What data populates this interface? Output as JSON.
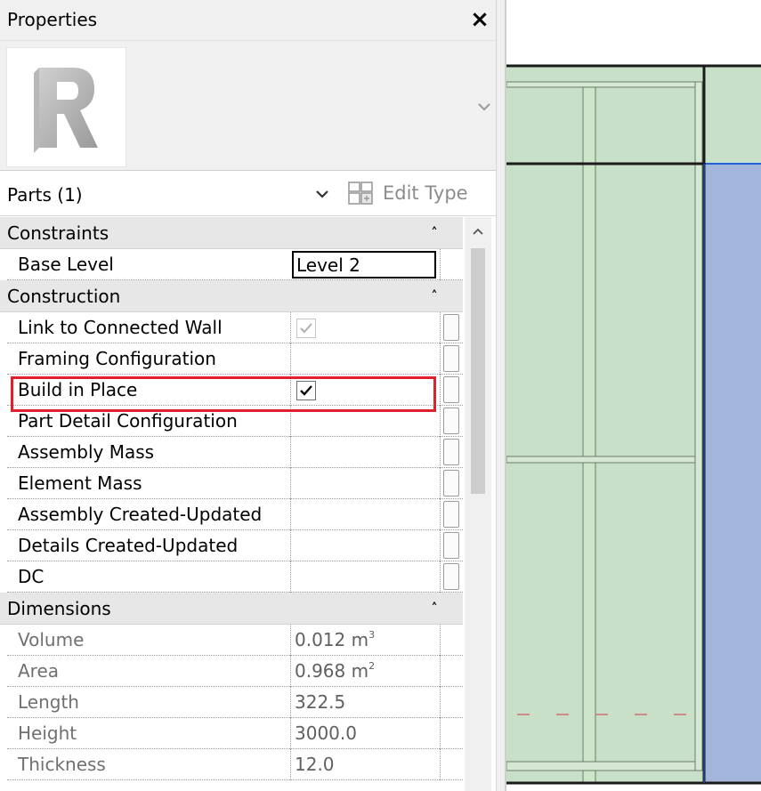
{
  "palette": {
    "title": "Properties",
    "close_glyph": "×",
    "type_image_icon": "revit-logo-icon",
    "filter_label": "Parts (1)",
    "edit_type_label": "Edit Type"
  },
  "groups": [
    {
      "label": "Constraints"
    },
    {
      "label": "Construction"
    },
    {
      "label": "Dimensions"
    }
  ],
  "constraints": {
    "base_level": {
      "name": "Base Level",
      "value": "Level 2"
    }
  },
  "construction": {
    "link_to_connected_wall": {
      "name": "Link to Connected Wall",
      "checked": true,
      "enabled": false
    },
    "framing_configuration": {
      "name": "Framing Configuration",
      "value": ""
    },
    "build_in_place": {
      "name": "Build in Place",
      "checked": true,
      "enabled": true
    },
    "part_detail_configuration": {
      "name": "Part Detail Configuration",
      "value": ""
    },
    "assembly_mass": {
      "name": "Assembly Mass",
      "value": ""
    },
    "element_mass": {
      "name": "Element Mass",
      "value": ""
    },
    "assembly_created_updated": {
      "name": "Assembly Created-Updated",
      "value": ""
    },
    "details_created_updated": {
      "name": "Details Created-Updated",
      "value": ""
    },
    "dc": {
      "name": "DC",
      "value": ""
    }
  },
  "dimensions": {
    "volume": {
      "name": "Volume",
      "value": "0.012 m",
      "unit_exp": "3"
    },
    "area": {
      "name": "Area",
      "value": "0.968 m",
      "unit_exp": "2"
    },
    "length": {
      "name": "Length",
      "value": "322.5"
    },
    "height": {
      "name": "Height",
      "value": "3000.0"
    },
    "thickness": {
      "name": "Thickness",
      "value": "12.0"
    }
  },
  "highlight": {
    "target": "Build in Place",
    "color": "#e0202a"
  },
  "colors": {
    "panel_green": "#c9e0c8",
    "stud_green": "#cde4c9",
    "wall_blue": "#a4b5dc",
    "line_dark": "#1a1a1a",
    "accent_blue": "#2060d8",
    "dash_red": "#d07070"
  }
}
